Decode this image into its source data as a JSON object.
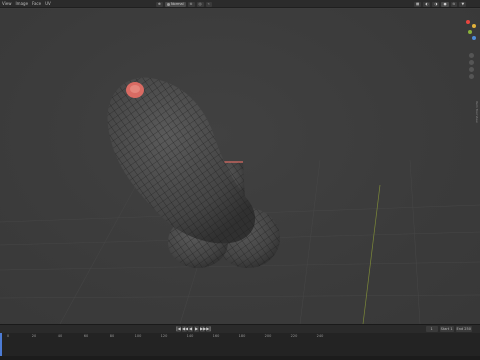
{
  "header": {
    "menu": [
      "View",
      "Image",
      "Face",
      "UV"
    ],
    "center_controls": [
      "⊕",
      "Normal",
      "⊙",
      "◎",
      "⌁"
    ],
    "right_controls": [
      "▦",
      "◐",
      "◑",
      "●",
      "⊙",
      "▼"
    ]
  },
  "viewport": {
    "nav_icons": [
      "zoom-icon",
      "pan-icon",
      "camera-icon",
      "grid-icon"
    ],
    "side_tab": "Item   Tool   View"
  },
  "colors": {
    "mesh_fill": "#4a4a4a",
    "wire": "#1e1e1e",
    "selected_faces": "#d96b63",
    "gizmo_x": "#e9463f",
    "gizmo_y": "#8bb13a",
    "gizmo_z": "#4f8dd8",
    "gizmo_extra": "#e2b23b",
    "playhead": "#4c7bd4"
  },
  "timeline": {
    "playback_buttons": [
      "|◀",
      "◀◀",
      "◀",
      "▶",
      "▶▶",
      "▶|"
    ],
    "frame_fields": [
      "1",
      "Start 1",
      "End 250"
    ],
    "ruler": [
      "0",
      "20",
      "40",
      "60",
      "80",
      "100",
      "120",
      "140",
      "160",
      "180",
      "200",
      "220",
      "240"
    ]
  }
}
